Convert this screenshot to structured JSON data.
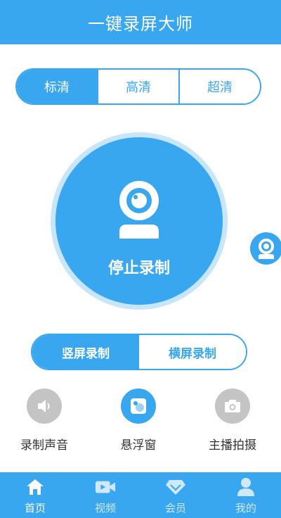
{
  "app": {
    "title": "一键录屏大师"
  },
  "quality": {
    "options": [
      "标清",
      "高清",
      "超清"
    ],
    "selected": "标清"
  },
  "record": {
    "label": "停止录制"
  },
  "orientation": {
    "options": [
      "竖屏录制",
      "横屏录制"
    ],
    "selected": "竖屏录制"
  },
  "tools": [
    {
      "label": "录制声音",
      "icon": "speaker-icon"
    },
    {
      "label": "悬浮窗",
      "icon": "floating-window-icon"
    },
    {
      "label": "主播拍摄",
      "icon": "camera-icon"
    }
  ],
  "nav": [
    {
      "label": "首页",
      "icon": "home-icon",
      "active": true
    },
    {
      "label": "视频",
      "icon": "video-icon"
    },
    {
      "label": "会员",
      "icon": "diamond-icon"
    },
    {
      "label": "我的",
      "icon": "person-icon"
    }
  ],
  "colors": {
    "accent": "#39a6f0",
    "ring": "#c7e6fb",
    "tool_gray": "#bdbdbd"
  }
}
